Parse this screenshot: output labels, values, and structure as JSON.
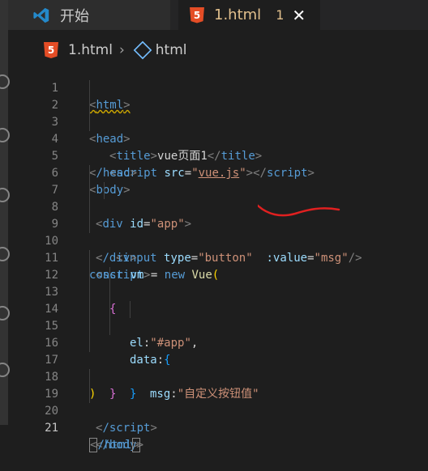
{
  "tabs": [
    {
      "label": "开始"
    },
    {
      "label": "1.html",
      "badge": "1",
      "close": "✕",
      "html5_glyph": "5"
    }
  ],
  "breadcrumb": {
    "file": "1.html",
    "separator": "›",
    "element": "html"
  },
  "editor": {
    "active_line": 21,
    "lines": [
      {
        "n": "1"
      },
      {
        "n": "2"
      },
      {
        "n": "3"
      },
      {
        "n": "4"
      },
      {
        "n": "5"
      },
      {
        "n": "6"
      },
      {
        "n": "7"
      },
      {
        "n": "8"
      },
      {
        "n": "9"
      },
      {
        "n": "10"
      },
      {
        "n": "11"
      },
      {
        "n": "12"
      },
      {
        "n": "13"
      },
      {
        "n": "14"
      },
      {
        "n": "15"
      },
      {
        "n": "16"
      },
      {
        "n": "17"
      },
      {
        "n": "18"
      },
      {
        "n": "19"
      },
      {
        "n": "20"
      },
      {
        "n": "21"
      }
    ],
    "code": {
      "l1_tag": "html",
      "l2_tag": "head",
      "l3_tag": "title",
      "l3_text": "vue页面1",
      "l4_tag": "script",
      "l4_attr": "src",
      "l4_val": "vue.js",
      "l5_tag": "/head",
      "l6_tag": "body",
      "l7_tag": "div",
      "l7_attr": "id",
      "l7_val": "app",
      "l8_tag": "input",
      "l8_attr1": "type",
      "l8_val1": "button",
      "l8_attr2": ":value",
      "l8_val2": "msg",
      "l9_tag": "/div",
      "l10_tag": "script",
      "l11_kw1": "const",
      "l11_var": "vm",
      "l11_op": "=",
      "l11_kw2": "new",
      "l11_fn": "Vue",
      "l13_key": "el",
      "l13_val": "\"#app\"",
      "l14_key": "data",
      "l15_key": "msg",
      "l15_val": "\"自定义按钮值\"",
      "l19_tag": "/script",
      "l20_tag": "/body",
      "l21_tag": "/html"
    }
  },
  "colors": {
    "annotation": "#e02020",
    "tag": "#569cd6",
    "string": "#ce9178",
    "attribute": "#9cdcfe"
  },
  "icons": [
    "vscode-logo-icon",
    "html5-icon",
    "close-icon",
    "symbol-element-icon"
  ]
}
